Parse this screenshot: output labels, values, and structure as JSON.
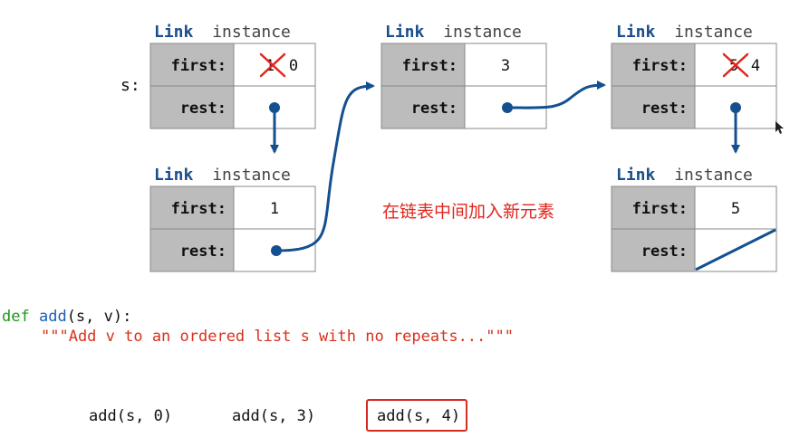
{
  "diagram": {
    "var_label": "s:",
    "title_keyword": "Link",
    "title_word": "instance",
    "field_first": "first:",
    "field_rest": "rest:",
    "links": [
      {
        "first_value": "0",
        "crossed_value": "1"
      },
      {
        "first_value": "3"
      },
      {
        "first_value": "4",
        "crossed_value": "5"
      },
      {
        "first_value": "1"
      },
      {
        "first_value": "5"
      }
    ],
    "annotation": "在链表中间加入新元素"
  },
  "code": {
    "def_keyword": "def",
    "func_name": "add",
    "signature": "(s, v):",
    "docstring": "\"\"\"Add v to an ordered list s with no repeats...\"\"\""
  },
  "calls": [
    "add(s, 0)",
    "add(s, 3)",
    "add(s, 4)"
  ],
  "selected_call_index": 2,
  "colors": {
    "arrow": "#14508f",
    "label_cell": "#bcbcbc",
    "keyword_link": "#1b4f8c",
    "cross": "#e0261e",
    "highlight": "#d62b22",
    "annotation": "#e0261e"
  }
}
